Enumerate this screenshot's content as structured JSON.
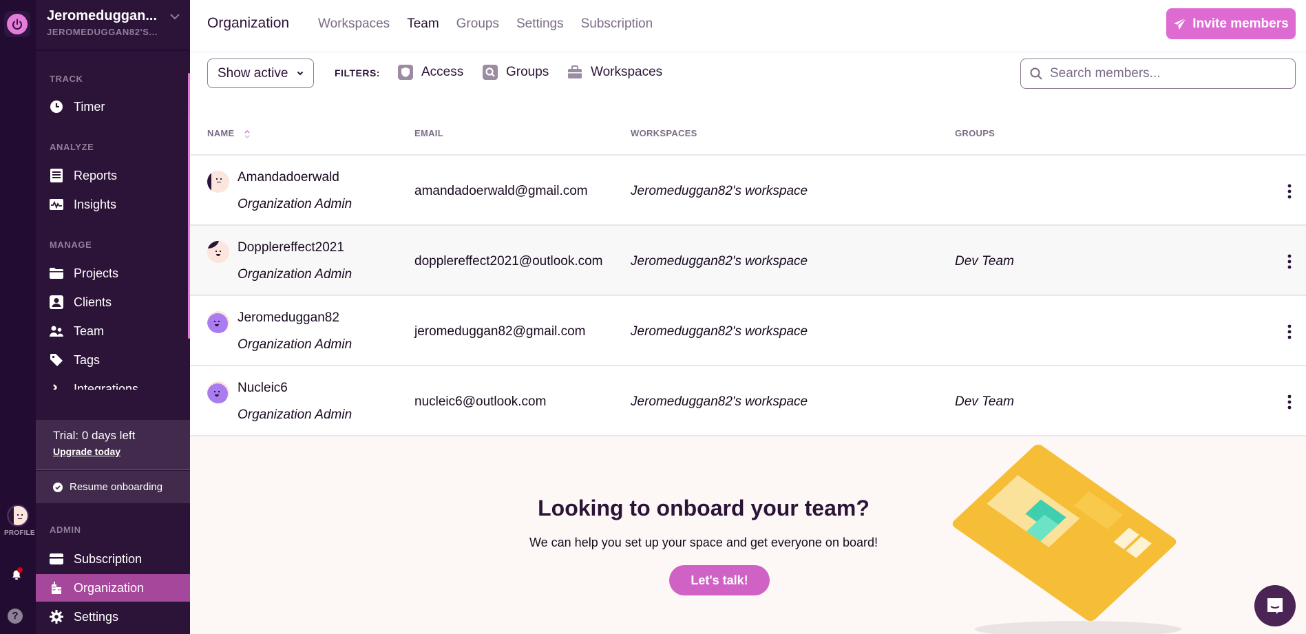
{
  "app": {
    "logo_icon": "power-icon",
    "workspace_name": "Jeromeduggan...",
    "workspace_sub": "JEROMEDUGGAN82'S..."
  },
  "rail": {
    "profile_label": "PROFILE",
    "help_glyph": "?"
  },
  "sidebar": {
    "sections": [
      {
        "label": "TRACK",
        "items": [
          {
            "label": "Timer",
            "icon": "clock-icon"
          }
        ]
      },
      {
        "label": "ANALYZE",
        "items": [
          {
            "label": "Reports",
            "icon": "report-icon"
          },
          {
            "label": "Insights",
            "icon": "insights-icon"
          }
        ]
      },
      {
        "label": "MANAGE",
        "items": [
          {
            "label": "Projects",
            "icon": "folder-icon"
          },
          {
            "label": "Clients",
            "icon": "client-icon"
          },
          {
            "label": "Team",
            "icon": "team-icon"
          },
          {
            "label": "Tags",
            "icon": "tag-icon"
          },
          {
            "label": "Integrations",
            "icon": "integrations-icon"
          }
        ]
      },
      {
        "label": "ADMIN",
        "items": [
          {
            "label": "Subscription",
            "icon": "card-icon"
          },
          {
            "label": "Organization",
            "icon": "building-icon",
            "active": true
          },
          {
            "label": "Settings",
            "icon": "gear-icon"
          }
        ]
      }
    ],
    "trial_text": "Trial: 0 days left",
    "upgrade_link": "Upgrade today",
    "resume_onboarding": "Resume onboarding"
  },
  "header": {
    "title": "Organization",
    "tabs": [
      {
        "label": "Workspaces",
        "active": false
      },
      {
        "label": "Team",
        "active": true
      },
      {
        "label": "Groups",
        "active": false
      },
      {
        "label": "Settings",
        "active": false
      },
      {
        "label": "Subscription",
        "active": false
      }
    ],
    "invite_label": "Invite members"
  },
  "filters": {
    "status_select": "Show active",
    "label": "FILTERS:",
    "items": [
      {
        "label": "Access",
        "icon": "shield-icon"
      },
      {
        "label": "Groups",
        "icon": "search-box-icon"
      },
      {
        "label": "Workspaces",
        "icon": "briefcase-icon"
      }
    ],
    "search_placeholder": "Search members...",
    "search_value": ""
  },
  "table": {
    "columns": [
      "NAME",
      "EMAIL",
      "WORKSPACES",
      "GROUPS"
    ],
    "rows": [
      {
        "name": "Amandadoerwald",
        "role": "Organization Admin",
        "email": "amandadoerwald@gmail.com",
        "workspace": "Jeromeduggan82's workspace",
        "group": ""
      },
      {
        "name": "Dopplereffect2021",
        "role": "Organization Admin",
        "email": "dopplereffect2021@outlook.com",
        "workspace": "Jeromeduggan82's workspace",
        "group": "Dev Team"
      },
      {
        "name": "Jeromeduggan82",
        "role": "Organization Admin",
        "email": "jeromeduggan82@gmail.com",
        "workspace": "Jeromeduggan82's workspace",
        "group": ""
      },
      {
        "name": "Nucleic6",
        "role": "Organization Admin",
        "email": "nucleic6@outlook.com",
        "workspace": "Jeromeduggan82's workspace",
        "group": "Dev Team"
      }
    ]
  },
  "promo": {
    "title": "Looking to onboard your team?",
    "text": "We can help you set up your space and get everyone on board!",
    "button": "Let's talk!"
  },
  "colors": {
    "accent": "#de6bd1",
    "sidebar_bg": "#2c1338",
    "rail_bg": "#230c31",
    "active_item": "#a5479b"
  }
}
